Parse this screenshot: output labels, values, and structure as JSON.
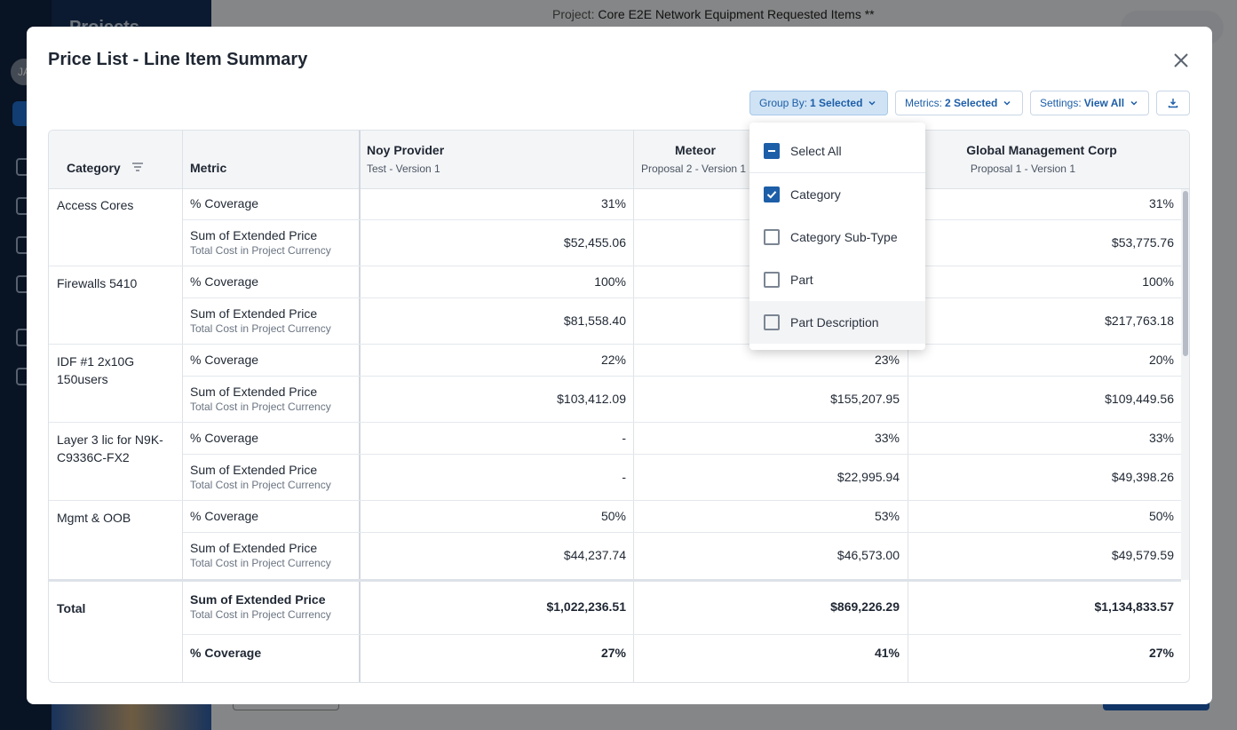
{
  "background": {
    "sidebar_title": "Projects",
    "project_label": "Project:",
    "project_name": "Core E2E Network Equipment Requested Items **",
    "user_initials": "JA"
  },
  "modal": {
    "title": "Price List - Line Item Summary"
  },
  "toolbar": {
    "group_by_key": "Group By:",
    "group_by_value": "1 Selected",
    "metrics_key": "Metrics:",
    "metrics_value": "2 Selected",
    "settings_key": "Settings:",
    "settings_value": "View All"
  },
  "table": {
    "headers": {
      "category": "Category",
      "metric": "Metric"
    },
    "suppliers": [
      {
        "name": "Noy Provider",
        "version": "Test - Version 1"
      },
      {
        "name": "Meteor",
        "version": "Proposal 2 - Version 1"
      },
      {
        "name": "Global Management Corp",
        "version": "Proposal 1 - Version 1"
      }
    ],
    "metric_coverage": "% Coverage",
    "metric_price": "Sum of Extended Price",
    "metric_price_sub": "Total Cost in Project Currency",
    "rows": [
      {
        "category": "Access Cores",
        "coverage": [
          "31%",
          "",
          "31%"
        ],
        "price": [
          "$52,455.06",
          "",
          "$53,775.76"
        ]
      },
      {
        "category": "Firewalls 5410",
        "coverage": [
          "100%",
          "",
          "100%"
        ],
        "price": [
          "$81,558.40",
          "",
          "$217,763.18"
        ]
      },
      {
        "category": "IDF #1 2x10G 150users",
        "coverage": [
          "22%",
          "23%",
          "20%"
        ],
        "price": [
          "$103,412.09",
          "$155,207.95",
          "$109,449.56"
        ]
      },
      {
        "category": "Layer 3 lic for N9K-C9336C-FX2",
        "coverage": [
          "-",
          "33%",
          "33%"
        ],
        "price": [
          "-",
          "$22,995.94",
          "$49,398.26"
        ]
      },
      {
        "category": "Mgmt & OOB",
        "coverage": [
          "50%",
          "53%",
          "50%"
        ],
        "price": [
          "$44,237.74",
          "$46,573.00",
          "$49,579.59"
        ]
      }
    ],
    "total": {
      "label": "Total",
      "price": [
        "$1,022,236.51",
        "$869,226.29",
        "$1,134,833.57"
      ],
      "coverage": [
        "27%",
        "41%",
        "27%"
      ]
    }
  },
  "group_by_dropdown": {
    "items": [
      {
        "label": "Select All",
        "state": "indeterminate"
      },
      {
        "label": "Category",
        "state": "checked"
      },
      {
        "label": "Category Sub-Type",
        "state": "unchecked"
      },
      {
        "label": "Part",
        "state": "unchecked"
      },
      {
        "label": "Part Description",
        "state": "unchecked"
      }
    ]
  },
  "colors": {
    "accent": "#1d5ea8",
    "group_by_bg": "#cfe3f5"
  }
}
